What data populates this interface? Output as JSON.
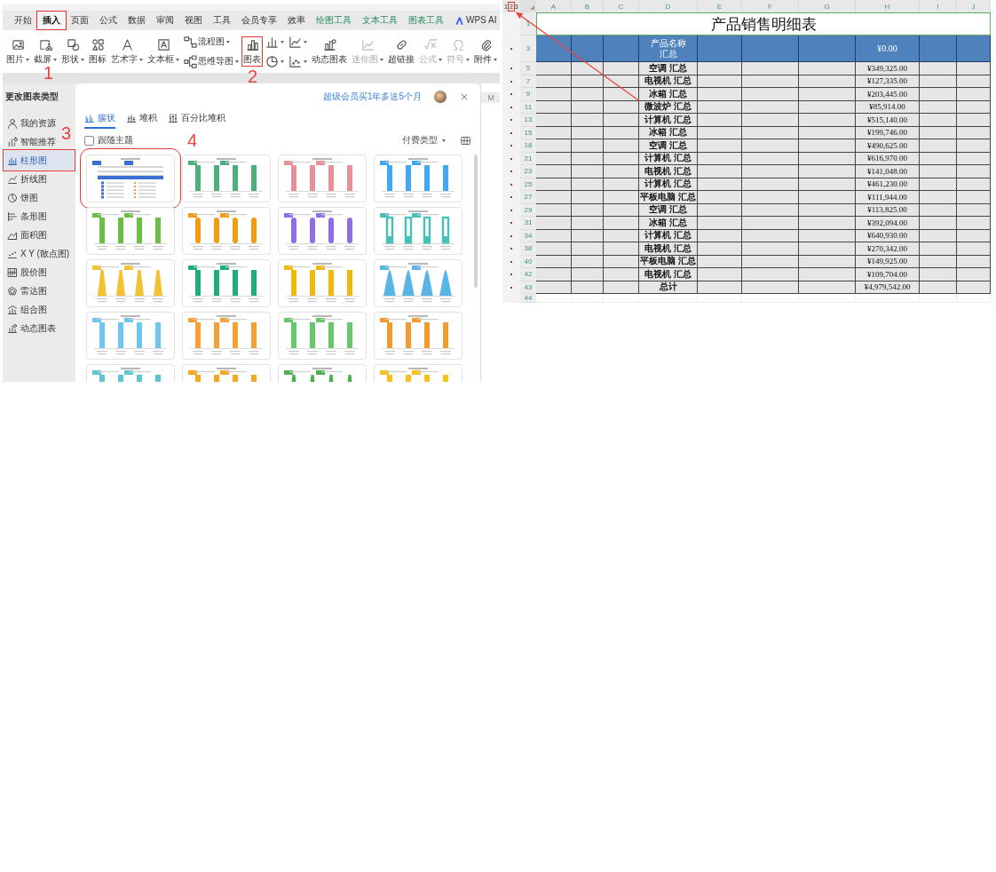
{
  "wps": {
    "ribbon_tabs": [
      {
        "label": "开始",
        "kind": "normal",
        "selected": false,
        "marked": false
      },
      {
        "label": "插入",
        "kind": "normal",
        "selected": true,
        "marked": true
      },
      {
        "label": "页面",
        "kind": "normal",
        "selected": false,
        "marked": false
      },
      {
        "label": "公式",
        "kind": "normal",
        "selected": false,
        "marked": false
      },
      {
        "label": "数据",
        "kind": "normal",
        "selected": false,
        "marked": false
      },
      {
        "label": "审阅",
        "kind": "normal",
        "selected": false,
        "marked": false
      },
      {
        "label": "视图",
        "kind": "normal",
        "selected": false,
        "marked": false
      },
      {
        "label": "工具",
        "kind": "normal",
        "selected": false,
        "marked": false
      },
      {
        "label": "会员专享",
        "kind": "normal",
        "selected": false,
        "marked": false
      },
      {
        "label": "效率",
        "kind": "normal",
        "selected": false,
        "marked": false
      },
      {
        "label": "绘图工具",
        "kind": "context",
        "selected": false,
        "marked": false
      },
      {
        "label": "文本工具",
        "kind": "context",
        "selected": false,
        "marked": false
      },
      {
        "label": "图表工具",
        "kind": "context",
        "selected": false,
        "marked": false
      },
      {
        "label": "WPS AI",
        "kind": "ai",
        "selected": false,
        "marked": false
      }
    ],
    "ribbon_tools": [
      {
        "kind": "large",
        "label": "图片",
        "dropdown": true,
        "disabled": false,
        "marked": false
      },
      {
        "kind": "large",
        "label": "截屏",
        "dropdown": true,
        "disabled": false,
        "marked": false
      },
      {
        "kind": "large",
        "label": "形状",
        "dropdown": true,
        "disabled": false,
        "marked": false
      },
      {
        "kind": "large",
        "label": "图标",
        "dropdown": false,
        "disabled": false,
        "marked": false
      },
      {
        "kind": "large",
        "label": "艺术字",
        "dropdown": true,
        "disabled": false,
        "marked": false
      },
      {
        "kind": "large",
        "label": "文本框",
        "dropdown": true,
        "disabled": false,
        "marked": false
      },
      {
        "kind": "stack",
        "items": [
          {
            "label": "流程图",
            "dropdown": true
          },
          {
            "label": "思维导图",
            "dropdown": true
          }
        ]
      },
      {
        "kind": "large",
        "label": "图表",
        "dropdown": false,
        "disabled": false,
        "marked": true
      },
      {
        "kind": "stack",
        "items": [
          {
            "dropdown": true
          },
          {
            "dropdown": true
          }
        ]
      },
      {
        "kind": "stack",
        "items": [
          {
            "dropdown": true
          },
          {
            "dropdown": true
          }
        ]
      },
      {
        "kind": "large",
        "label": "动态图表",
        "dropdown": false,
        "disabled": false,
        "marked": false
      },
      {
        "kind": "large",
        "label": "迷你图",
        "dropdown": true,
        "disabled": true,
        "marked": false
      },
      {
        "kind": "large",
        "label": "超链接",
        "dropdown": false,
        "disabled": false,
        "marked": false
      },
      {
        "kind": "large",
        "label": "公式",
        "dropdown": true,
        "disabled": true,
        "marked": false
      },
      {
        "kind": "large",
        "label": "符号",
        "dropdown": true,
        "disabled": true,
        "marked": false
      },
      {
        "kind": "large",
        "label": "附件",
        "dropdown": true,
        "disabled": false,
        "marked": false
      }
    ],
    "background_column": "M",
    "dialog": {
      "title": "更改图表类型",
      "sidebar": [
        {
          "label": "我的资源",
          "selected": false,
          "marked": false
        },
        {
          "label": "智能推荐",
          "selected": false,
          "marked": false
        },
        {
          "label": "柱形图",
          "selected": true,
          "marked": true
        },
        {
          "label": "折线图",
          "selected": false,
          "marked": false
        },
        {
          "label": "饼图",
          "selected": false,
          "marked": false
        },
        {
          "label": "条形图",
          "selected": false,
          "marked": false
        },
        {
          "label": "面积图",
          "selected": false,
          "marked": false
        },
        {
          "label": "X Y (散点图)",
          "selected": false,
          "marked": false
        },
        {
          "label": "股价图",
          "selected": false,
          "marked": false
        },
        {
          "label": "雷达图",
          "selected": false,
          "marked": false
        },
        {
          "label": "组合图",
          "selected": false,
          "marked": false
        },
        {
          "label": "动态图表",
          "selected": false,
          "marked": false
        }
      ],
      "promo": "超级会员买1年多送5个月",
      "tabs": [
        {
          "label": "簇状",
          "selected": true
        },
        {
          "label": "堆积",
          "selected": false
        },
        {
          "label": "百分比堆积",
          "selected": false
        }
      ],
      "follow_theme": {
        "label": "跟随主题",
        "checked": false
      },
      "filter": "付费类型",
      "thumbnails": [
        {
          "kind": "table",
          "color": "#3b6fd6",
          "marked": true
        },
        {
          "kind": "bar",
          "color": "#4caf7d",
          "marked": false
        },
        {
          "kind": "bar",
          "color": "#e88f98",
          "marked": false
        },
        {
          "kind": "bar",
          "color": "#3fa9f5",
          "marked": false
        },
        {
          "kind": "bar",
          "color": "#6abf45",
          "marked": false
        },
        {
          "kind": "pill",
          "color": "#f39c12",
          "marked": false
        },
        {
          "kind": "pill",
          "color": "#8f6ee8",
          "marked": false
        },
        {
          "kind": "outline",
          "color": "#45c1b8",
          "marked": false
        },
        {
          "kind": "spike",
          "color": "#f2c230",
          "marked": false
        },
        {
          "kind": "bar",
          "color": "#1fae77",
          "marked": false
        },
        {
          "kind": "bar",
          "color": "#f2b90c",
          "marked": false
        },
        {
          "kind": "cone",
          "color": "#5ab4e5",
          "marked": false
        },
        {
          "kind": "bar",
          "color": "#6cc6ee",
          "marked": false
        },
        {
          "kind": "bar",
          "color": "#f5a035",
          "marked": false
        },
        {
          "kind": "bar",
          "color": "#63c96a",
          "marked": false
        },
        {
          "kind": "bar",
          "color": "#f29a2e",
          "marked": false
        },
        {
          "kind": "bar",
          "color": "#5cc6d0",
          "marked": false
        },
        {
          "kind": "bar",
          "color": "#f5a623",
          "marked": false
        },
        {
          "kind": "spike",
          "color": "#4caf50",
          "marked": false
        },
        {
          "kind": "bar",
          "color": "#f5c21b",
          "marked": false
        }
      ]
    }
  },
  "sheet": {
    "outline_levels": [
      {
        "label": "1",
        "marked": false
      },
      {
        "label": "2",
        "marked": true
      },
      {
        "label": "3",
        "marked": false
      }
    ],
    "columns": [
      "A",
      "B",
      "C",
      "D",
      "E",
      "F",
      "G",
      "H",
      "I",
      "J"
    ],
    "title": {
      "row": "1",
      "text": "产品销售明细表"
    },
    "header": {
      "row": "3",
      "product": "产品名称汇总",
      "amount": "¥0.00"
    },
    "rows": [
      {
        "row": "5",
        "product": "空调 汇总",
        "amount": "¥349,325.00"
      },
      {
        "row": "7",
        "product": "电视机 汇总",
        "amount": "¥127,335.00"
      },
      {
        "row": "9",
        "product": "冰箱 汇总",
        "amount": "¥203,445.00"
      },
      {
        "row": "11",
        "product": "微波炉 汇总",
        "amount": "¥85,914.00"
      },
      {
        "row": "13",
        "product": "计算机 汇总",
        "amount": "¥515,140.00"
      },
      {
        "row": "15",
        "product": "冰箱 汇总",
        "amount": "¥199,746.00"
      },
      {
        "row": "18",
        "product": "空调 汇总",
        "amount": "¥490,625.00"
      },
      {
        "row": "21",
        "product": "计算机 汇总",
        "amount": "¥616,970.00"
      },
      {
        "row": "23",
        "product": "电视机 汇总",
        "amount": "¥141,048.00"
      },
      {
        "row": "25",
        "product": "计算机 汇总",
        "amount": "¥461,230.00"
      },
      {
        "row": "27",
        "product": "平板电脑 汇总",
        "amount": "¥111,944.00"
      },
      {
        "row": "29",
        "product": "空调 汇总",
        "amount": "¥113,825.00"
      },
      {
        "row": "31",
        "product": "冰箱 汇总",
        "amount": "¥392,094.00"
      },
      {
        "row": "34",
        "product": "计算机 汇总",
        "amount": "¥640,930.00"
      },
      {
        "row": "38",
        "product": "电视机 汇总",
        "amount": "¥270,342.00"
      },
      {
        "row": "40",
        "product": "平板电脑 汇总",
        "amount": "¥149,925.00"
      },
      {
        "row": "42",
        "product": "电视机 汇总",
        "amount": "¥109,704.00"
      },
      {
        "row": "43",
        "product": "总计",
        "amount": "¥4,979,542.00"
      }
    ],
    "empty_rows": [
      "44"
    ]
  },
  "annotations": [
    "1",
    "2",
    "3",
    "4"
  ]
}
